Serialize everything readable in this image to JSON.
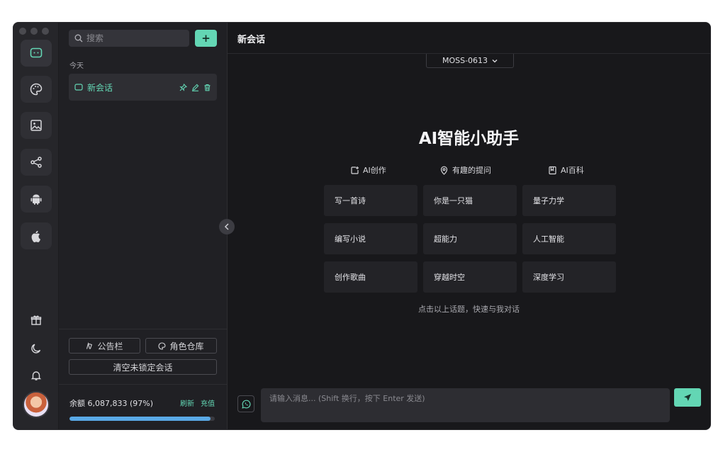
{
  "sidebar": {
    "search_placeholder": "搜索",
    "add_label": "+",
    "section_today": "今天",
    "conversation_title": "新会话",
    "notice_board": "公告栏",
    "role_store": "角色仓库",
    "clear_unlocked": "清空未锁定会话",
    "balance": "余额 6,087,833 (97%)",
    "balance_fraction": 0.97,
    "refresh": "刷新",
    "recharge": "充值"
  },
  "rail": {
    "icons": [
      "chat-icon",
      "palette-icon",
      "image-icon",
      "share-icon",
      "android-icon",
      "apple-icon",
      "gift-icon",
      "moon-icon",
      "bell-icon"
    ]
  },
  "main": {
    "title": "新会话",
    "model": "MOSS-0613",
    "hero_title": "AI智能小助手",
    "categories": [
      "AI创作",
      "有趣的提问",
      "AI百科"
    ],
    "topics": [
      [
        "写一首诗",
        "你是一只猫",
        "量子力学"
      ],
      [
        "编写小说",
        "超能力",
        "人工智能"
      ],
      [
        "创作歌曲",
        "穿越时空",
        "深度学习"
      ]
    ],
    "hint": "点击以上话题，快速与我对话",
    "input_placeholder": "请输入消息... (Shift 换行，按下 Enter 发送)"
  },
  "colors": {
    "accent": "#63d6b4",
    "background": "#18181b",
    "sidebar": "#202024",
    "progress": "#5aa9e6"
  }
}
